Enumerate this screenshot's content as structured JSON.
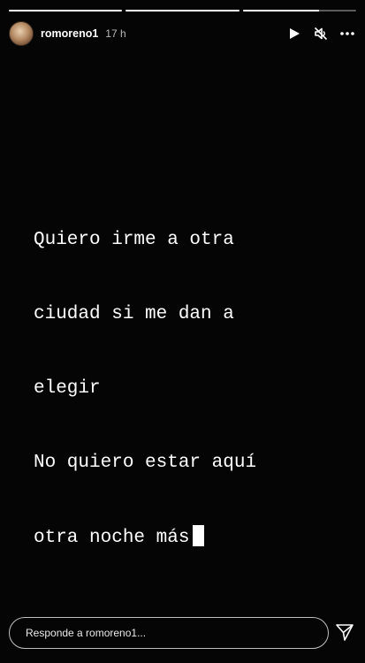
{
  "progress": [
    {
      "fill": 1.0
    },
    {
      "fill": 1.0
    },
    {
      "fill": 0.67
    }
  ],
  "header": {
    "username": "romoreno1",
    "time_ago": "17 h",
    "play_icon": "play-icon",
    "mute_icon": "volume-muted-icon",
    "more_icon": "more-horizontal-icon"
  },
  "story": {
    "lines": [
      "Quiero irme a otra",
      "ciudad si me dan a",
      "elegir",
      "No quiero estar aquí",
      "otra noche más"
    ]
  },
  "reply": {
    "placeholder": "Responde a romoreno1...",
    "value": "",
    "send_icon": "send-icon"
  },
  "colors": {
    "background": "#050505",
    "text": "#ffffff"
  }
}
